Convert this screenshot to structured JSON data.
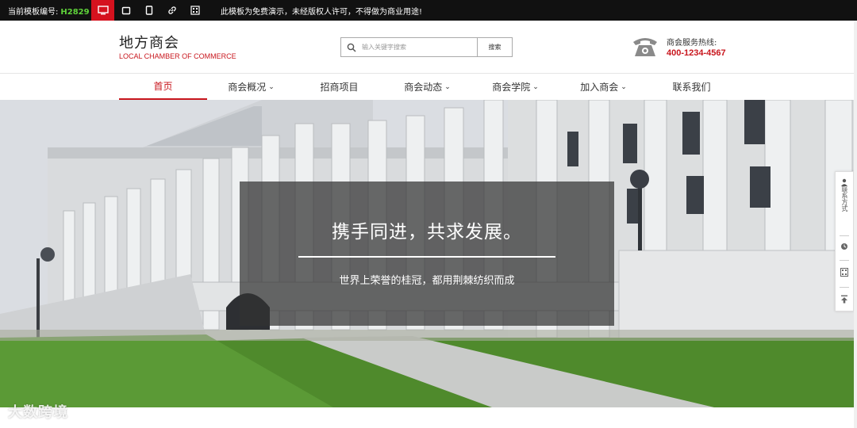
{
  "topbar": {
    "code_label": "当前模板编号:",
    "code_value": "H2829",
    "devices": [
      "desktop-icon",
      "tablet-landscape-icon",
      "tablet-icon",
      "link-icon",
      "qrcode-icon"
    ],
    "notice": "此模板为免费演示，未经版权人许可，不得做为商业用途!"
  },
  "header": {
    "logo_title": "地方商会",
    "logo_sub": "LOCAL CHAMBER OF COMMERCE",
    "search_placeholder": "输入关键字搜索",
    "search_button": "搜索",
    "hotline_label": "商会服务热线:",
    "hotline_number": "400-1234-4567"
  },
  "nav": {
    "items": [
      {
        "label": "首页",
        "caret": ""
      },
      {
        "label": "商会概况",
        "caret": "⌄"
      },
      {
        "label": "招商项目",
        "caret": ""
      },
      {
        "label": "商会动态",
        "caret": "⌄"
      },
      {
        "label": "商会学院",
        "caret": "⌄"
      },
      {
        "label": "加入商会",
        "caret": "⌄"
      },
      {
        "label": "联系我们",
        "caret": ""
      }
    ],
    "active_index": 0
  },
  "banner": {
    "slogan": "携手同进，共求发展。",
    "subslogan": "世界上荣誉的桂冠，都用荆棘纺织而成"
  },
  "sidefloat": {
    "contact_label": "联系方式"
  },
  "watermark": "大数跨境",
  "colors": {
    "brand_red": "#c8161d",
    "topbar_bg": "#111111",
    "code_green": "#5fd33a"
  }
}
